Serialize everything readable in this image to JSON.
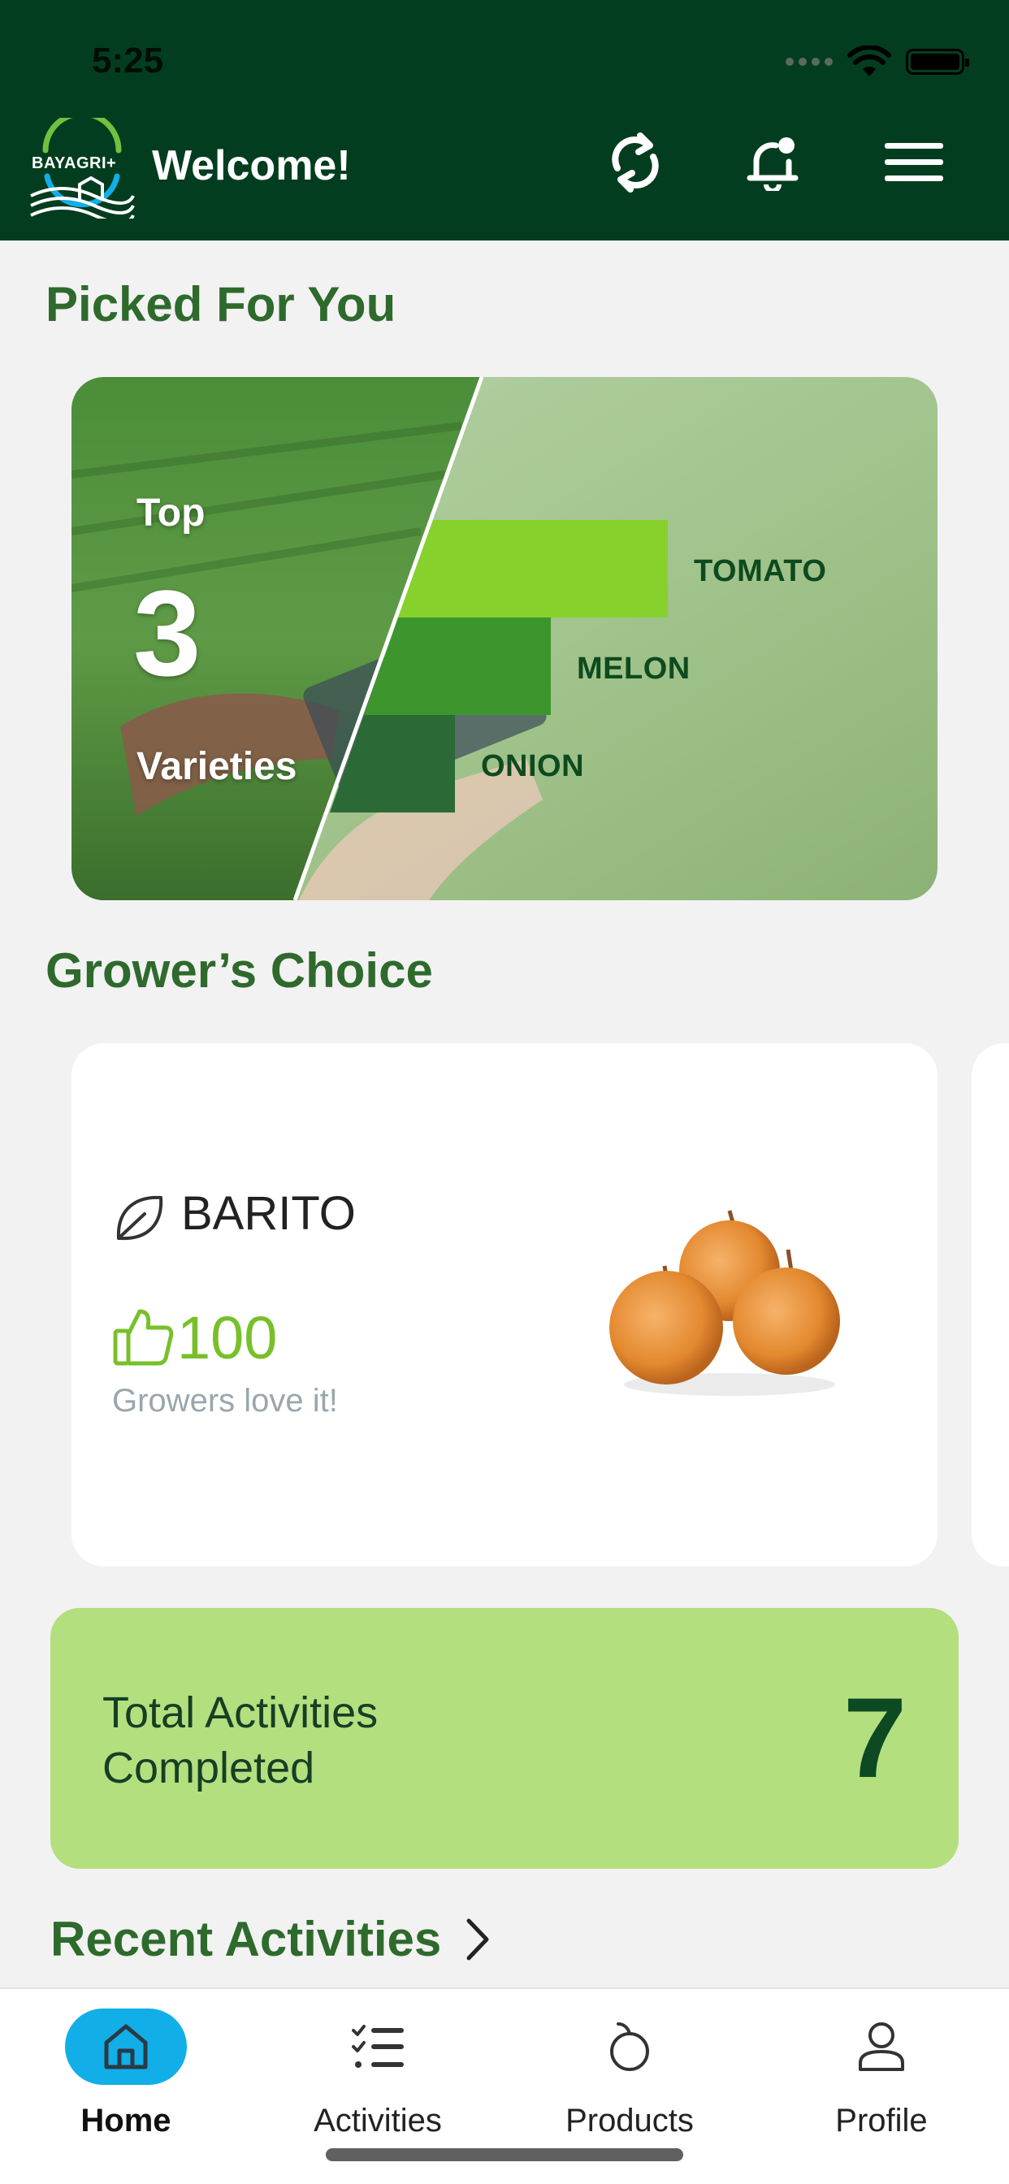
{
  "status_bar": {
    "time": "5:25"
  },
  "header": {
    "logo_text": "BAYAGRI+",
    "welcome": "Welcome!",
    "icons": [
      "sync-icon",
      "notification-bell-icon",
      "menu-icon"
    ]
  },
  "picked_for_you": {
    "title": "Picked For You",
    "banner": {
      "top": "Top",
      "number": "3",
      "varieties": "Varieties",
      "crops": [
        "TOMATO",
        "MELON",
        "ONION"
      ]
    }
  },
  "growers_choice": {
    "title": "Grower’s Choice",
    "card": {
      "variety": "BARITO",
      "likes": "100",
      "caption": "Growers love it!"
    }
  },
  "activities_summary": {
    "label": "Total Activities Completed",
    "value": "7"
  },
  "recent_activities": {
    "title": "Recent Activities"
  },
  "bottom_nav": {
    "items": [
      {
        "label": "Home",
        "icon": "home-icon",
        "active": true
      },
      {
        "label": "Activities",
        "icon": "checklist-icon",
        "active": false
      },
      {
        "label": "Products",
        "icon": "apple-icon",
        "active": false
      },
      {
        "label": "Profile",
        "icon": "person-icon",
        "active": false
      }
    ]
  },
  "colors": {
    "header": "#033d1f",
    "title_green": "#2e6a2c",
    "summary_card": "#b3df7f",
    "nav_active": "#12aee8",
    "likes_green": "#78c02a"
  }
}
